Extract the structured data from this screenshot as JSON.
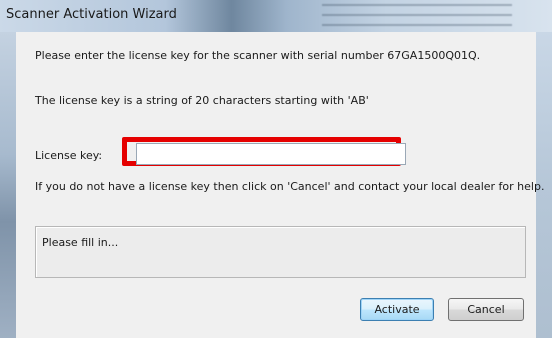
{
  "window": {
    "title": "Scanner Activation Wizard"
  },
  "dialog": {
    "serial_text": "Please enter the license key for the scanner with serial number 67GA1500Q01Q.",
    "rule_text": "The license key is a string of 20 characters starting with 'AB'",
    "license_label": "License key:",
    "license_value": "",
    "help_text": "If you do not have a license key then click on 'Cancel' and contact your local dealer for help.",
    "message": "Please fill in...",
    "buttons": {
      "activate": "Activate",
      "cancel": "Cancel"
    }
  },
  "colors": {
    "highlight": "#e50000",
    "default_button_border": "#3c7fb1"
  }
}
